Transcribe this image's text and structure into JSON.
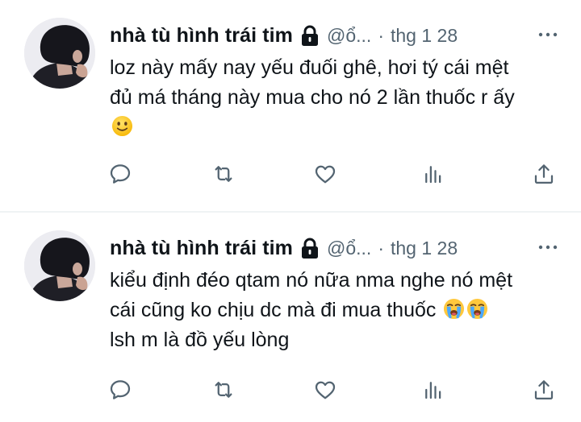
{
  "colors": {
    "text": "#0f1419",
    "secondary": "#536471",
    "divider": "#eff3f4"
  },
  "tweets": [
    {
      "author_name": "nhà tù hình trái tim",
      "handle": "@ổ...",
      "separator": "·",
      "timestamp": "thg 1 28",
      "locked_icon": "lock-icon",
      "lines": [
        "loz này mấy nay yếu đuối ghê, hơi tý cái mệt",
        "đủ má tháng này mua cho nó 2 lần thuốc r ấy",
        ""
      ],
      "emojis": [
        "slightly-smiling-face-emoji"
      ],
      "actions": [
        "reply-icon",
        "retweet-icon",
        "like-icon",
        "views-icon",
        "share-icon"
      ]
    },
    {
      "author_name": "nhà tù hình trái tim",
      "handle": "@ổ...",
      "separator": "·",
      "timestamp": "thg 1 28",
      "locked_icon": "lock-icon",
      "lines": [
        "kiểu định đéo qtam nó nữa nma nghe nó mệt",
        "cái cũng ko chịu dc mà đi mua thuốc ",
        "lsh m là đồ yếu lòng"
      ],
      "emojis": [
        "loudly-crying-face-emoji",
        "loudly-crying-face-emoji"
      ],
      "actions": [
        "reply-icon",
        "retweet-icon",
        "like-icon",
        "views-icon",
        "share-icon"
      ]
    }
  ]
}
